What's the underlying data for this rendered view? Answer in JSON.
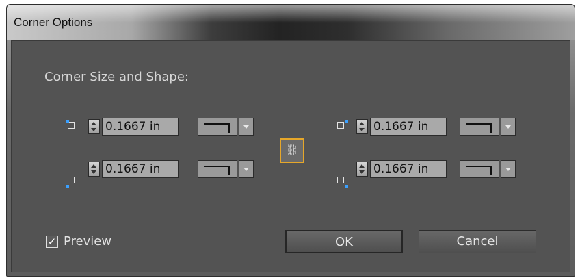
{
  "window": {
    "title": "Corner Options"
  },
  "section": {
    "label": "Corner Size and Shape:"
  },
  "corners": [
    {
      "name": "top-left",
      "value": "0.1667 in"
    },
    {
      "name": "top-right",
      "value": "0.1667 in"
    },
    {
      "name": "bottom-left",
      "value": "0.1667 in"
    },
    {
      "name": "bottom-right",
      "value": "0.1667 in"
    }
  ],
  "preview": {
    "label": "Preview",
    "checked": true,
    "check_glyph": "✓"
  },
  "buttons": {
    "ok_label": "OK",
    "cancel_label": "Cancel"
  },
  "link_button": {
    "icon": "chain-link-icon",
    "glyph": "⛓"
  },
  "colors": {
    "accent": "#e6a72a",
    "corner_dot": "#3aa0ff",
    "panel": "#535353"
  }
}
